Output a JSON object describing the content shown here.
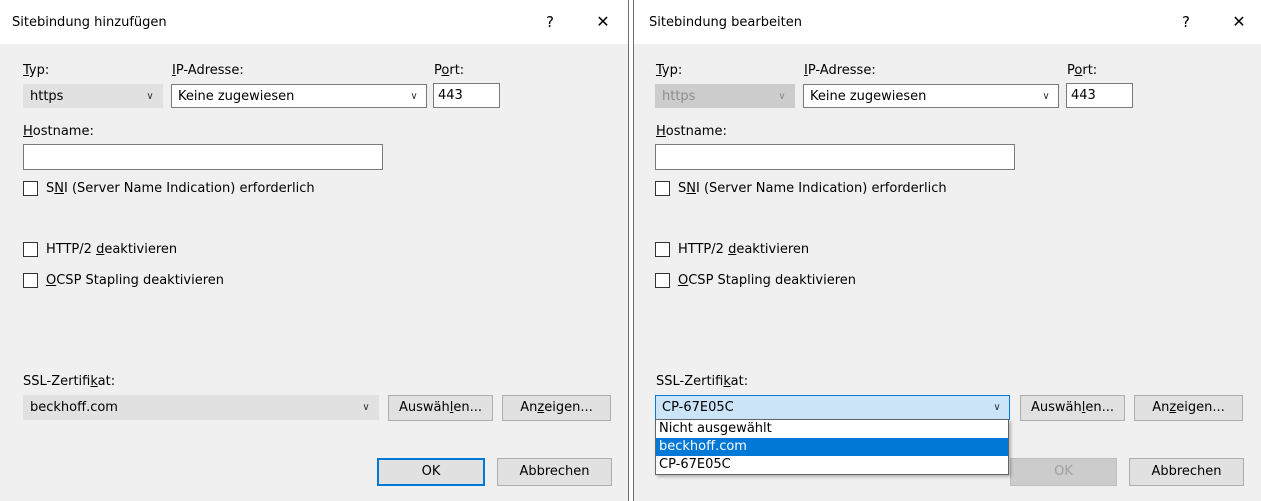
{
  "left": {
    "title": "Sitebindung hinzufügen",
    "help": "?",
    "close": "✕",
    "type": {
      "label_pre": "",
      "label_key": "T",
      "label_post": "yp:",
      "value": "https"
    },
    "ip": {
      "label_pre": "",
      "label_key": "I",
      "label_post": "P-Adresse:",
      "value": "Keine zugewiesen"
    },
    "port": {
      "label_pre": "P",
      "label_key": "o",
      "label_post": "rt:",
      "value": "443"
    },
    "hostname": {
      "label_pre": "",
      "label_key": "H",
      "label_post": "ostname:",
      "value": ""
    },
    "sni": {
      "pre": "S",
      "key": "N",
      "post": "I (Server Name Indication) erforderlich"
    },
    "http2": {
      "pre": "HTTP/2 ",
      "key": "d",
      "post": "eaktivieren"
    },
    "ocsp": {
      "pre": "",
      "key": "O",
      "post": "CSP Stapling deaktivieren"
    },
    "ssl": {
      "label_pre": "SSL-Zertifi",
      "label_key": "k",
      "label_post": "at:",
      "value": "beckhoff.com"
    },
    "select_btn": {
      "pre": "Auswäh",
      "key": "l",
      "post": "en..."
    },
    "view_btn": {
      "pre": "An",
      "key": "z",
      "post": "eigen..."
    },
    "ok": "OK",
    "cancel": "Abbrechen"
  },
  "right": {
    "title": "Sitebindung bearbeiten",
    "help": "?",
    "close": "✕",
    "type": {
      "label_pre": "",
      "label_key": "T",
      "label_post": "yp:",
      "value": "https"
    },
    "ip": {
      "label_pre": "",
      "label_key": "I",
      "label_post": "P-Adresse:",
      "value": "Keine zugewiesen"
    },
    "port": {
      "label_pre": "P",
      "label_key": "o",
      "label_post": "rt:",
      "value": "443"
    },
    "hostname": {
      "label_pre": "",
      "label_key": "H",
      "label_post": "ostname:",
      "value": ""
    },
    "sni": {
      "pre": "S",
      "key": "N",
      "post": "I (Server Name Indication) erforderlich"
    },
    "http2": {
      "pre": "HTTP/2 ",
      "key": "d",
      "post": "eaktivieren"
    },
    "ocsp": {
      "pre": "",
      "key": "O",
      "post": "CSP Stapling deaktivieren"
    },
    "ssl": {
      "label_pre": "SSL-Zertifi",
      "label_key": "k",
      "label_post": "at:",
      "value": "CP-67E05C"
    },
    "dropdown": [
      "Nicht ausgewählt",
      "beckhoff.com",
      "CP-67E05C"
    ],
    "select_btn": {
      "pre": "Auswäh",
      "key": "l",
      "post": "en..."
    },
    "view_btn": {
      "pre": "An",
      "key": "z",
      "post": "eigen..."
    },
    "ok": "OK",
    "cancel": "Abbrechen"
  },
  "colors": {
    "accent": "#0078d7",
    "dialog_bg": "#f0f0f0",
    "selection": "#0078d7"
  }
}
